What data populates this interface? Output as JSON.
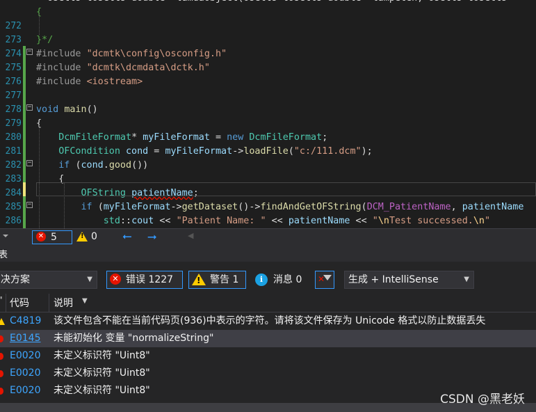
{
  "editor": {
    "lines": [
      {
        "num": "",
        "tokens": [
          {
            "t": "  ",
            "c": "pl"
          },
          {
            "t": "osetts tosetts double  lamdaobject(osetts tosetts double  lampeten, osetts tosetts",
            "c": "pl"
          }
        ]
      },
      {
        "num": "",
        "tokens": [
          {
            "t": "{",
            "c": "cm"
          }
        ]
      },
      {
        "num": "272",
        "tokens": []
      },
      {
        "num": "273",
        "tokens": [
          {
            "t": "}*/",
            "c": "cm"
          }
        ]
      },
      {
        "num": "274",
        "tokens": [
          {
            "t": "#include ",
            "c": "pp"
          },
          {
            "t": "\"dcmtk\\config\\osconfig.h\"",
            "c": "str"
          }
        ]
      },
      {
        "num": "275",
        "tokens": [
          {
            "t": "#include ",
            "c": "pp"
          },
          {
            "t": "\"dcmtk\\dcmdata\\dctk.h\"",
            "c": "str"
          }
        ]
      },
      {
        "num": "276",
        "tokens": [
          {
            "t": "#include ",
            "c": "pp"
          },
          {
            "t": "<iostream>",
            "c": "str"
          }
        ]
      },
      {
        "num": "277",
        "tokens": []
      },
      {
        "num": "278",
        "tokens": [
          {
            "t": "void ",
            "c": "kw"
          },
          {
            "t": "main",
            "c": "fn"
          },
          {
            "t": "()",
            "c": "pl"
          }
        ]
      },
      {
        "num": "279",
        "tokens": [
          {
            "t": "{",
            "c": "pl"
          }
        ]
      },
      {
        "num": "280",
        "tokens": [
          {
            "t": "    "
          },
          {
            "t": "DcmFileFormat",
            "c": "type"
          },
          {
            "t": "* ",
            "c": "pl"
          },
          {
            "t": "myFileFormat",
            "c": "var"
          },
          {
            "t": " = ",
            "c": "pl"
          },
          {
            "t": "new ",
            "c": "kw"
          },
          {
            "t": "DcmFileFormat",
            "c": "type"
          },
          {
            "t": ";",
            "c": "pl"
          }
        ]
      },
      {
        "num": "281",
        "tokens": [
          {
            "t": "    "
          },
          {
            "t": "OFCondition",
            "c": "type"
          },
          {
            "t": " ",
            "c": "pl"
          },
          {
            "t": "cond",
            "c": "var"
          },
          {
            "t": " = ",
            "c": "pl"
          },
          {
            "t": "myFileFormat",
            "c": "var"
          },
          {
            "t": "->",
            "c": "pl"
          },
          {
            "t": "loadFile",
            "c": "fn"
          },
          {
            "t": "(",
            "c": "pl"
          },
          {
            "t": "\"c:/111.dcm\"",
            "c": "str"
          },
          {
            "t": ");",
            "c": "pl"
          }
        ]
      },
      {
        "num": "282",
        "tokens": [
          {
            "t": "    "
          },
          {
            "t": "if ",
            "c": "kw"
          },
          {
            "t": "(",
            "c": "pl"
          },
          {
            "t": "cond",
            "c": "var"
          },
          {
            "t": ".",
            "c": "pl"
          },
          {
            "t": "good",
            "c": "fn"
          },
          {
            "t": "())",
            "c": "pl"
          }
        ]
      },
      {
        "num": "283",
        "tokens": [
          {
            "t": "    {",
            "c": "pl"
          }
        ]
      },
      {
        "num": "284",
        "tokens": [
          {
            "t": "        "
          },
          {
            "t": "OFString",
            "c": "type"
          },
          {
            "t": " ",
            "c": "pl"
          },
          {
            "t": "patientName",
            "c": "var",
            "sq": true
          },
          {
            "t": ";",
            "c": "pl"
          }
        ]
      },
      {
        "num": "285",
        "tokens": [
          {
            "t": "        "
          },
          {
            "t": "if ",
            "c": "kw"
          },
          {
            "t": "(",
            "c": "pl"
          },
          {
            "t": "myFileFormat",
            "c": "var"
          },
          {
            "t": "->",
            "c": "pl"
          },
          {
            "t": "getDataset",
            "c": "fn"
          },
          {
            "t": "()->",
            "c": "pl"
          },
          {
            "t": "findAndGetOFString",
            "c": "fn"
          },
          {
            "t": "(",
            "c": "pl"
          },
          {
            "t": "DCM_PatientName",
            "c": "mac"
          },
          {
            "t": ", ",
            "c": "pl"
          },
          {
            "t": "patientName",
            "c": "var"
          }
        ]
      },
      {
        "num": "286",
        "tokens": [
          {
            "t": "            "
          },
          {
            "t": "std",
            "c": "type"
          },
          {
            "t": "::",
            "c": "pl"
          },
          {
            "t": "cout",
            "c": "var"
          },
          {
            "t": " << ",
            "c": "pl"
          },
          {
            "t": "\"Patient Name: \"",
            "c": "str"
          },
          {
            "t": " << ",
            "c": "pl"
          },
          {
            "t": "patientName",
            "c": "var"
          },
          {
            "t": " << ",
            "c": "pl"
          },
          {
            "t": "\"",
            "c": "str"
          },
          {
            "t": "\\n",
            "c": "esc"
          },
          {
            "t": "Test successed.",
            "c": "str"
          },
          {
            "t": "\\n",
            "c": "esc"
          },
          {
            "t": "\"",
            "c": "str"
          }
        ]
      }
    ]
  },
  "editor_status": {
    "error_count": "5",
    "warning_count": "0"
  },
  "panel": {
    "title": "表"
  },
  "toolbar": {
    "scope_label": "决方案",
    "errors_label": "错误 1227",
    "warnings_label": "警告 1",
    "messages_label": "消息 0",
    "build_filter_label": "生成 + IntelliSense"
  },
  "columns": {
    "code_header": "代码",
    "desc_header": "说明"
  },
  "rows": [
    {
      "severity": "warning",
      "code": "C4819",
      "desc": "该文件包含不能在当前代码页(936)中表示的字符。请将该文件保存为 Unicode 格式以防止数据丢失",
      "link": false
    },
    {
      "severity": "error",
      "code": "E0145",
      "desc": "未能初始化 变量 \"normalizeString\"",
      "link": true
    },
    {
      "severity": "error",
      "code": "E0020",
      "desc": "未定义标识符 \"Uint8\"",
      "link": false
    },
    {
      "severity": "error",
      "code": "E0020",
      "desc": "未定义标识符 \"Uint8\"",
      "link": false
    },
    {
      "severity": "error",
      "code": "E0020",
      "desc": "未定义标识符 \"Uint8\"",
      "link": false
    }
  ],
  "watermark": "CSDN @黑老妖",
  "colors": {
    "error": "#e51400",
    "warning": "#ffcc00",
    "info": "#1ba1e2",
    "accent": "#3399ff"
  }
}
